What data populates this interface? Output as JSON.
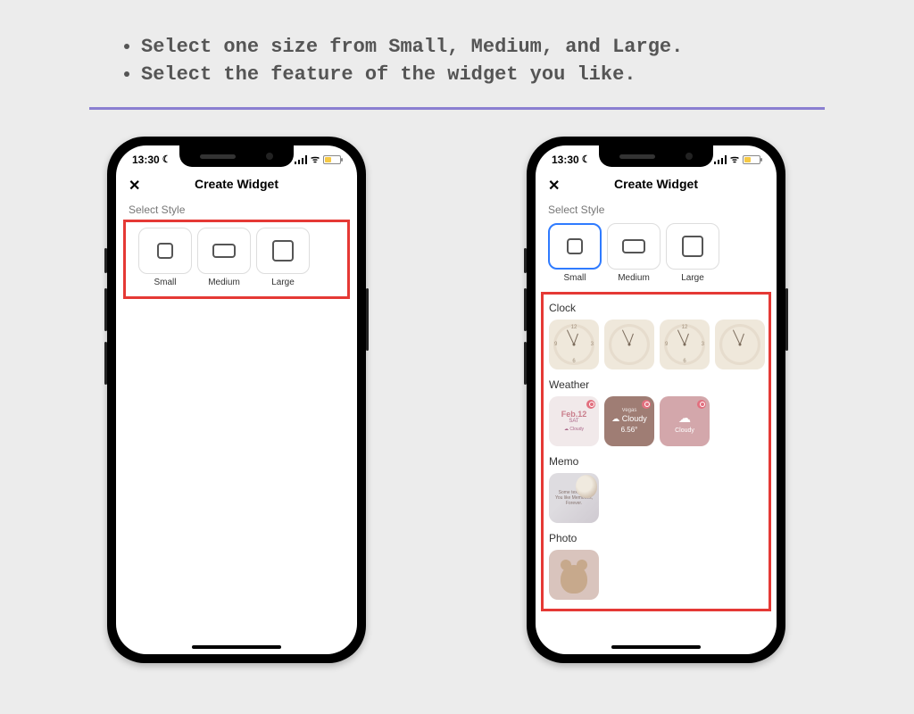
{
  "instructions": {
    "item1": "Select one size from Small, Medium, and Large.",
    "item2": "Select the feature of the widget you like."
  },
  "status": {
    "time": "13:30"
  },
  "nav": {
    "title": "Create Widget"
  },
  "section": {
    "select_style": "Select Style"
  },
  "sizes": {
    "small": "Small",
    "medium": "Medium",
    "large": "Large"
  },
  "categories": {
    "clock": "Clock",
    "weather": "Weather",
    "memo": "Memo",
    "photo": "Photo"
  },
  "weather": {
    "card1_date": "Feb.12",
    "card1_day": "SAT",
    "card1_detail": "☁ Cloudy",
    "card2_city": "Vegas",
    "card2_cond": "☁ Cloudy",
    "card2_temp": "6.56°",
    "card3_cloud": "☁",
    "card3_txt": "Cloudy"
  },
  "memo": {
    "line1": "Some text to let",
    "line2": "You like Memories,",
    "line3": "Forever."
  }
}
